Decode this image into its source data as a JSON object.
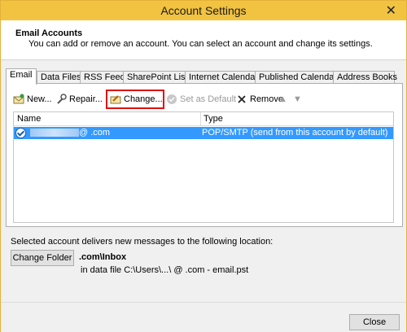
{
  "window": {
    "title": "Account Settings",
    "close_glyph": "✕"
  },
  "header": {
    "title": "Email Accounts",
    "subtitle": "You can add or remove an account. You can select an account and change its settings."
  },
  "tabs": [
    "Email",
    "Data Files",
    "RSS Feeds",
    "SharePoint Lists",
    "Internet Calendars",
    "Published Calendars",
    "Address Books"
  ],
  "toolbar": {
    "new": "New...",
    "repair": "Repair...",
    "change": "Change...",
    "set_default": "Set as Default",
    "remove": "Remove",
    "up": "▲",
    "down": "▼"
  },
  "list": {
    "columns": [
      "Name",
      "Type"
    ],
    "rows": [
      {
        "name_suffix": "@ .com",
        "type": "POP/SMTP (send from this account by default)"
      }
    ]
  },
  "delivery": {
    "label": "Selected account delivers new messages to the following location:",
    "button": "Change Folder",
    "inbox": ".com\\Inbox",
    "datafile": "in data file C:\\Users\\...\\ @ .com - email.pst"
  },
  "footer": {
    "close": "Close"
  },
  "colors": {
    "title_bar": "#f2c340",
    "selection": "#3399ff",
    "highlight_border": "#e01010"
  }
}
